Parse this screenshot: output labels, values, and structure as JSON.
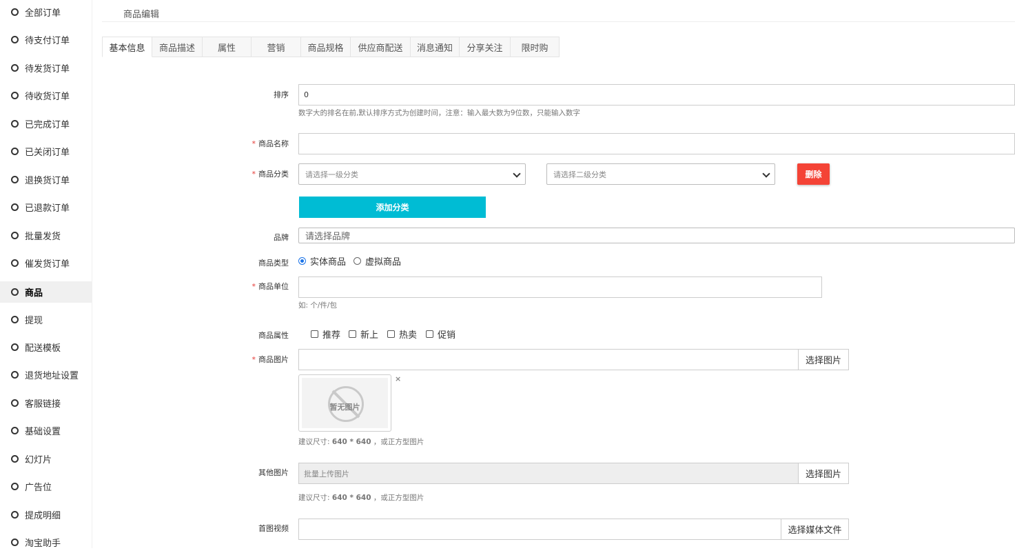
{
  "sidebar": {
    "items": [
      {
        "label": "全部订单"
      },
      {
        "label": "待支付订单"
      },
      {
        "label": "待发货订单"
      },
      {
        "label": "待收货订单"
      },
      {
        "label": "已完成订单"
      },
      {
        "label": "已关闭订单"
      },
      {
        "label": "退换货订单"
      },
      {
        "label": "已退款订单"
      },
      {
        "label": "批量发货"
      },
      {
        "label": "催发货订单"
      },
      {
        "label": "商品",
        "active": true
      },
      {
        "label": "提现"
      },
      {
        "label": "配送模板"
      },
      {
        "label": "退货地址设置"
      },
      {
        "label": "客服链接"
      },
      {
        "label": "基础设置"
      },
      {
        "label": "幻灯片"
      },
      {
        "label": "广告位"
      },
      {
        "label": "提成明细"
      },
      {
        "label": "淘宝助手"
      }
    ]
  },
  "header": {
    "breadcrumb": "商品编辑"
  },
  "tabs": [
    {
      "label": "基本信息",
      "active": true
    },
    {
      "label": "商品描述"
    },
    {
      "label": "属性"
    },
    {
      "label": "营销"
    },
    {
      "label": "商品规格"
    },
    {
      "label": "供应商配送"
    },
    {
      "label": "消息通知"
    },
    {
      "label": "分享关注"
    },
    {
      "label": "限时购"
    }
  ],
  "form": {
    "sort": {
      "label": "排序",
      "value": "0",
      "hint": "数字大的排名在前,默认排序方式为创建时间，注意：输入最大数为9位数，只能输入数字"
    },
    "name": {
      "label": "商品名称",
      "required": "*",
      "value": ""
    },
    "category": {
      "label": "商品分类",
      "required": "*",
      "first_placeholder": "请选择一级分类",
      "second_placeholder": "请选择二级分类",
      "delete_label": "删除",
      "add_label": "添加分类"
    },
    "brand": {
      "label": "品牌",
      "placeholder": "请选择品牌"
    },
    "type": {
      "label": "商品类型",
      "options": [
        "实体商品",
        "虚拟商品"
      ],
      "selected": "实体商品"
    },
    "unit": {
      "label": "商品单位",
      "required": "*",
      "value": "",
      "hint": "如: 个/件/包"
    },
    "attrs": {
      "label": "商品属性",
      "options": [
        "推荐",
        "新上",
        "热卖",
        "促销"
      ]
    },
    "image": {
      "label": "商品图片",
      "required": "*",
      "button": "选择图片",
      "no_image_text": "暂无图片",
      "remove": "×",
      "hint_prefix": "建议尺寸: ",
      "hint_size": "640 * 640",
      "hint_suffix": " ，或正方型图片"
    },
    "other_images": {
      "label": "其他图片",
      "placeholder": "批量上传图片",
      "button": "选择图片",
      "hint_prefix": "建议尺寸: ",
      "hint_size": "640 * 640",
      "hint_suffix": " ，或正方型图片"
    },
    "video": {
      "label": "首图视频",
      "button": "选择媒体文件"
    }
  },
  "colors": {
    "danger": "#f44336",
    "accent": "#00bcd4",
    "radio": "#1a73e8"
  }
}
